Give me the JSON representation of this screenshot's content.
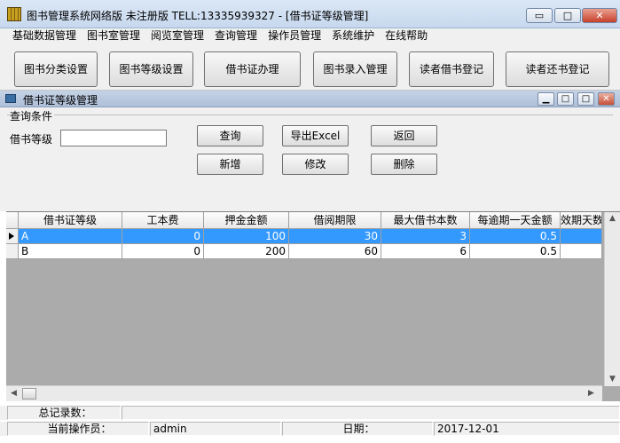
{
  "window": {
    "title": "图书管理系统网络版 未注册版 TELL:13335939327 - [借书证等级管理]",
    "min_glyph": "▭",
    "max_glyph": "□",
    "close_glyph": "✕"
  },
  "menu": [
    "基础数据管理",
    "图书室管理",
    "阅览室管理",
    "查询管理",
    "操作员管理",
    "系统维护",
    "在线帮助"
  ],
  "toolbar": [
    "图书分类设置",
    "图书等级设置",
    "借书证办理",
    "图书录入管理",
    "读者借书登记",
    "读者还书登记"
  ],
  "child": {
    "title": "借书证等级管理",
    "min_glyph": "▁",
    "max_glyph": "□",
    "close_glyph": "✕"
  },
  "query": {
    "group_label": "查询条件",
    "field_label": "借书等级",
    "field_value": "",
    "buttons": {
      "query": "查询",
      "export": "导出Excel",
      "back": "返回",
      "add": "新增",
      "edit": "修改",
      "delete": "删除"
    }
  },
  "grid": {
    "columns": [
      "借书证等级",
      "工本费",
      "押金金额",
      "借阅期限",
      "最大借书本数",
      "每逾期一天金额",
      "效期天数"
    ],
    "rows": [
      [
        "A",
        "0",
        "100",
        "30",
        "3",
        "0.5",
        ""
      ],
      [
        "B",
        "0",
        "200",
        "60",
        "6",
        "0.5",
        ""
      ]
    ],
    "selected_row": 0
  },
  "status": {
    "record_label": "总记录数：",
    "record_value": "",
    "operator_label": "当前操作员：",
    "operator_value": "admin",
    "date_label": "日期：",
    "date_value": "2017-12-01"
  }
}
